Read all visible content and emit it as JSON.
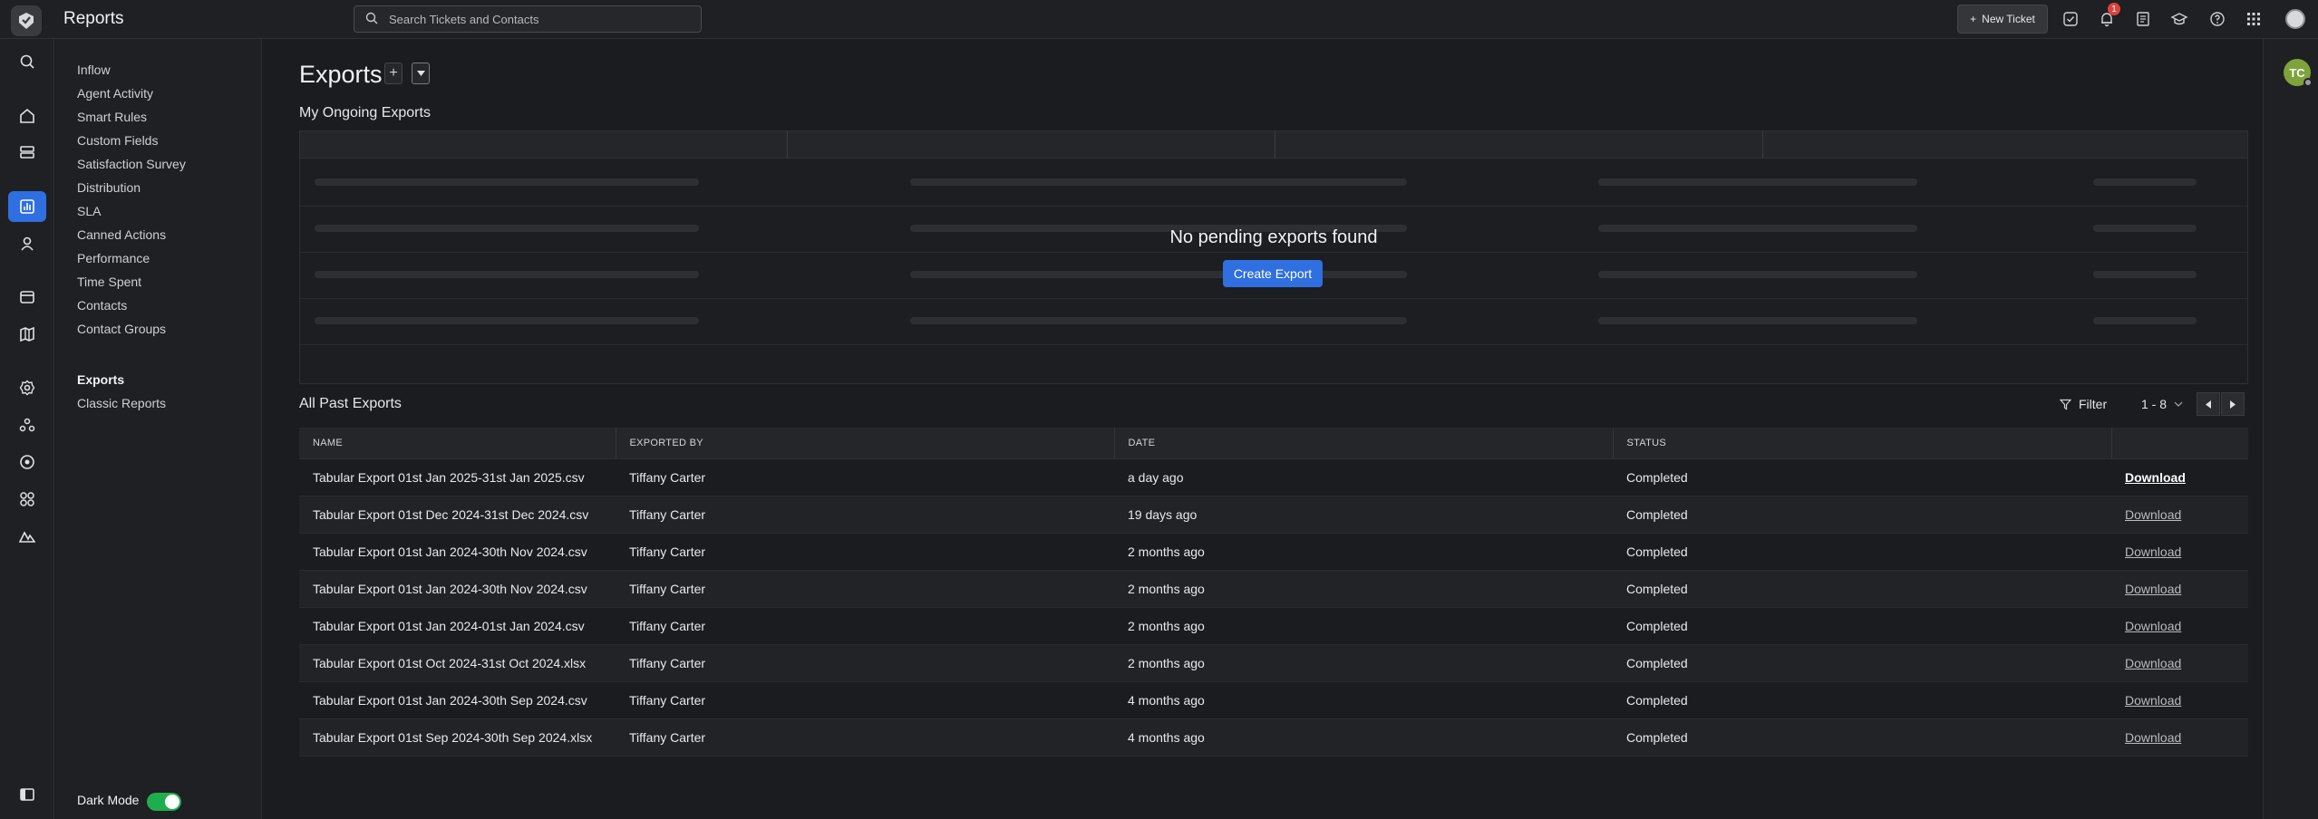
{
  "header": {
    "app_title": "Reports",
    "search_placeholder": "Search Tickets and Contacts",
    "new_ticket_label": "New Ticket",
    "notification_count": "1"
  },
  "rail": {
    "icons": [
      "search-icon",
      "home-icon",
      "tickets-icon",
      "reports-icon",
      "contacts-icon",
      "inbox-icon",
      "knowledge-base-icon",
      "settings-icon",
      "team-icon",
      "activity-icon",
      "apps-icon",
      "brand-icon",
      "sidebar-toggle-icon"
    ],
    "active": "reports-icon"
  },
  "sidebar": {
    "items": [
      "Inflow",
      "Agent Activity",
      "Smart Rules",
      "Custom Fields",
      "Satisfaction Survey",
      "Distribution",
      "SLA",
      "Canned Actions",
      "Performance",
      "Time Spent",
      "Contacts",
      "Contact Groups"
    ],
    "secondary": [
      "Exports",
      "Classic Reports"
    ],
    "dark_mode_label": "Dark Mode",
    "dark_mode_on": true
  },
  "main": {
    "title": "Exports",
    "ongoing_title": "My Ongoing Exports",
    "empty_message": "No pending exports found",
    "create_button": "Create Export",
    "past_title": "All Past Exports",
    "filter_label": "Filter",
    "page_range": "1 - 8",
    "columns": [
      "NAME",
      "EXPORTED BY",
      "DATE",
      "STATUS",
      ""
    ],
    "rows": [
      {
        "name": "Tabular Export 01st Jan 2025-31st Jan 2025.csv",
        "by": "Tiffany Carter",
        "date": "a day ago",
        "status": "Completed",
        "action": "Download"
      },
      {
        "name": "Tabular Export 01st Dec 2024-31st Dec 2024.csv",
        "by": "Tiffany Carter",
        "date": "19 days ago",
        "status": "Completed",
        "action": "Download"
      },
      {
        "name": "Tabular Export 01st Jan 2024-30th Nov 2024.csv",
        "by": "Tiffany Carter",
        "date": "2 months ago",
        "status": "Completed",
        "action": "Download"
      },
      {
        "name": "Tabular Export 01st Jan 2024-30th Nov 2024.csv",
        "by": "Tiffany Carter",
        "date": "2 months ago",
        "status": "Completed",
        "action": "Download"
      },
      {
        "name": "Tabular Export 01st Jan 2024-01st Jan 2024.csv",
        "by": "Tiffany Carter",
        "date": "2 months ago",
        "status": "Completed",
        "action": "Download"
      },
      {
        "name": "Tabular Export 01st Oct 2024-31st Oct 2024.xlsx",
        "by": "Tiffany Carter",
        "date": "2 months ago",
        "status": "Completed",
        "action": "Download"
      },
      {
        "name": "Tabular Export 01st Jan 2024-30th Sep 2024.csv",
        "by": "Tiffany Carter",
        "date": "4 months ago",
        "status": "Completed",
        "action": "Download"
      },
      {
        "name": "Tabular Export 01st Sep 2024-30th Sep 2024.xlsx",
        "by": "Tiffany Carter",
        "date": "4 months ago",
        "status": "Completed",
        "action": "Download"
      }
    ]
  },
  "user": {
    "initials": "TC"
  },
  "colors": {
    "accent": "#2f6fe0",
    "toggle_on": "#1fae4d",
    "badge": "#e0413d",
    "avatar": "#7ea33a"
  }
}
